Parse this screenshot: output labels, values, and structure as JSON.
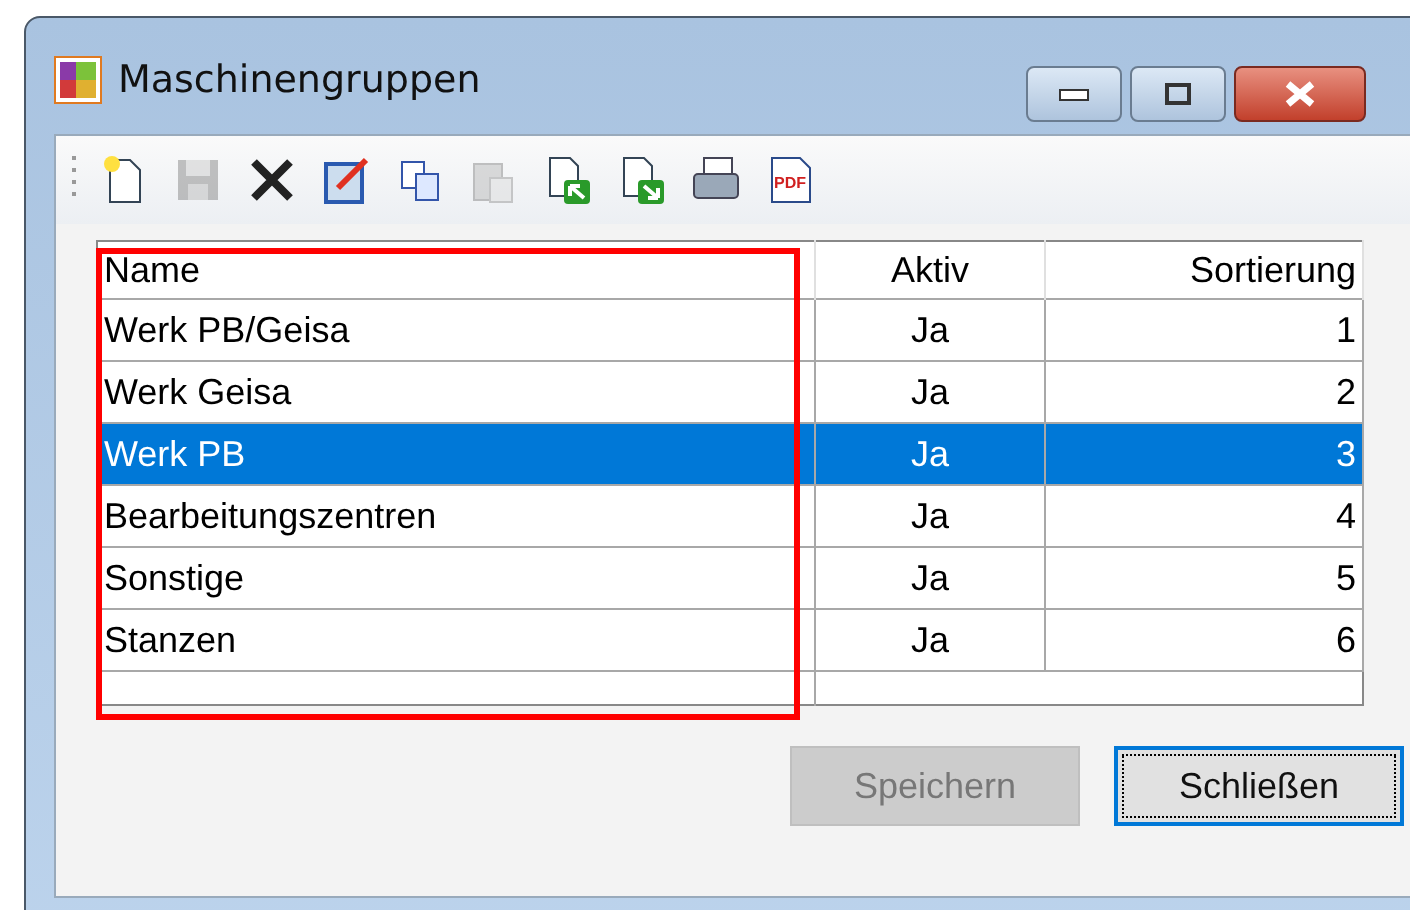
{
  "window": {
    "title": "Maschinengruppen"
  },
  "toolbar": [
    {
      "kind": "new",
      "disabled": false
    },
    {
      "kind": "save",
      "disabled": true
    },
    {
      "kind": "delete",
      "disabled": false
    },
    {
      "kind": "edit",
      "disabled": false
    },
    {
      "kind": "copy",
      "disabled": false
    },
    {
      "kind": "paste",
      "disabled": true
    },
    {
      "kind": "import",
      "disabled": false
    },
    {
      "kind": "export",
      "disabled": false
    },
    {
      "kind": "print",
      "disabled": false
    },
    {
      "kind": "pdf",
      "disabled": false,
      "label": "PDF"
    }
  ],
  "table": {
    "columns": [
      "Name",
      "Aktiv",
      "Sortierung"
    ],
    "rows": [
      {
        "cells": [
          "Werk PB/Geisa",
          "Ja",
          "1"
        ],
        "selected": false
      },
      {
        "cells": [
          "Werk Geisa",
          "Ja",
          "2"
        ],
        "selected": false
      },
      {
        "cells": [
          "Werk PB",
          "Ja",
          "3"
        ],
        "selected": true
      },
      {
        "cells": [
          "Bearbeitungszentren",
          "Ja",
          "4"
        ],
        "selected": false
      },
      {
        "cells": [
          "Sonstige",
          "Ja",
          "5"
        ],
        "selected": false
      },
      {
        "cells": [
          "Stanzen",
          "Ja",
          "6"
        ],
        "selected": false
      }
    ]
  },
  "buttons": [
    {
      "label": "Speichern",
      "disabled": true,
      "focused": false
    },
    {
      "label": "Schließen",
      "disabled": false,
      "focused": true
    }
  ]
}
